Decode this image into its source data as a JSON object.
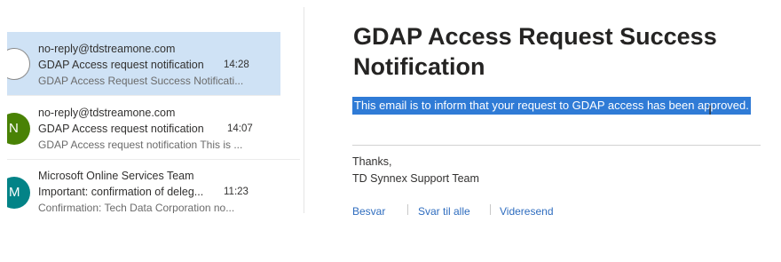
{
  "mail_list": {
    "items": [
      {
        "avatar_initial": "",
        "sender": "no-reply@tdstreamone.com",
        "subject": "GDAP Access request notification",
        "time": "14:28",
        "preview": "GDAP Access Request Success Notificati...",
        "selected": true
      },
      {
        "avatar_initial": "N",
        "avatar_color": "#498205",
        "sender": "no-reply@tdstreamone.com",
        "subject": "GDAP Access request notification",
        "time": "14:07",
        "preview": "GDAP Access request notification This is ...",
        "selected": false
      },
      {
        "avatar_initial": "M",
        "avatar_color": "#038387",
        "sender": "Microsoft Online Services Team",
        "subject": "Important: confirmation of deleg...",
        "time": "11:23",
        "preview": "Confirmation: Tech Data Corporation no...",
        "selected": false
      }
    ]
  },
  "reading_pane": {
    "subject": "GDAP Access Request Success Notification",
    "body": "This email is to inform that your request to GDAP access has been approved.",
    "closing": "Thanks,",
    "signature": "TD Synnex Support Team",
    "actions": [
      "Besvar",
      "Svar til alle",
      "Videresend"
    ]
  },
  "colors": {
    "selection_highlight": "#2f7bd6",
    "selected_row": "#cfe2f5",
    "link": "#2f6dbf"
  }
}
